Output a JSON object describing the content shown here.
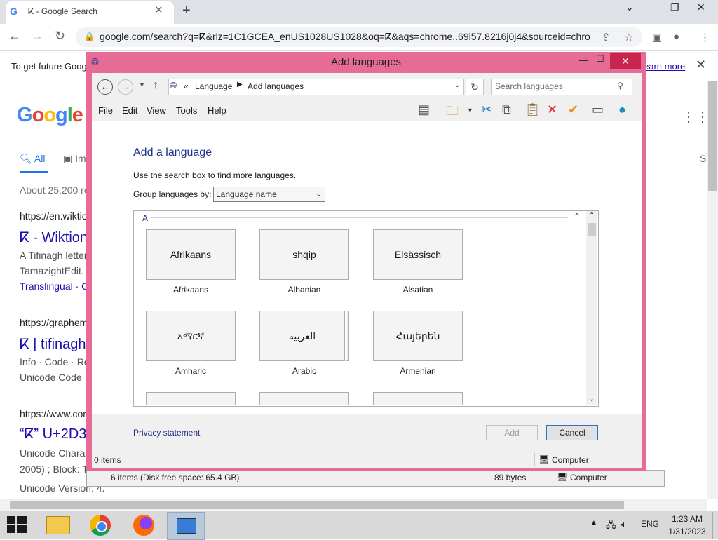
{
  "browser": {
    "tab_title": "ⴽ - Google Search",
    "tab_favicon": "G",
    "url": "google.com/search?q=ⴽ&rlz=1C1GCEA_enUS1028US1028&oq=ⴽ&aqs=chrome..69i57.8216j0j4&sourceid=chro..."
  },
  "page": {
    "infobar_text": "To get future Goog",
    "learn_more": "earn more",
    "logo_letters": [
      "G",
      "o",
      "o",
      "g",
      "l",
      "e"
    ],
    "tab_all": "All",
    "tab_images": "Im",
    "tab_right": "S",
    "about": "About 25,200 re",
    "results": [
      {
        "cite": "https://en.wiktio",
        "title": "ⴽ - Wiktion",
        "snippet1": "A Tifinagh letter",
        "snippet2": "TamazightEdit.",
        "link": "Translingual · C"
      },
      {
        "cite": "https://graphem",
        "title": "ⴽ | tifinagh",
        "snippet1": "Info · Code · Re",
        "snippet2": "Unicode Code"
      },
      {
        "cite": "https://www.cor",
        "title": "“ⴽ” U+2D3",
        "snippet1": "Unicode Chara",
        "snippet2": "2005) ; Block: T",
        "snippet3": "Unicode Version: 4."
      }
    ]
  },
  "bg_explorer": {
    "items": "6 items (Disk free space: 65.4 GB)",
    "size": "89 bytes",
    "location": "Computer"
  },
  "dialog": {
    "title": "Add languages",
    "breadcrumb_sep": "«",
    "crumb1": "Language",
    "crumb2": "Add languages",
    "search_placeholder": "Search languages",
    "menu": [
      "File",
      "Edit",
      "View",
      "Tools",
      "Help"
    ],
    "heading": "Add a language",
    "instruction": "Use the search box to find more languages.",
    "group_label": "Group languages by:",
    "group_value": "Language name",
    "letter": "A",
    "languages": [
      {
        "native": "Afrikaans",
        "name": "Afrikaans"
      },
      {
        "native": "shqip",
        "name": "Albanian"
      },
      {
        "native": "Elsässisch",
        "name": "Alsatian"
      },
      {
        "native": "አማርኛ",
        "name": "Amharic"
      },
      {
        "native": "العربية",
        "name": "Arabic"
      },
      {
        "native": "Հայերեն",
        "name": "Armenian"
      }
    ],
    "privacy": "Privacy statement",
    "add_button": "Add",
    "cancel_button": "Cancel",
    "status_items": "0 items",
    "status_location": "Computer"
  },
  "taskbar": {
    "language": "ENG",
    "time": "1:23 AM",
    "date": "1/31/2023"
  }
}
